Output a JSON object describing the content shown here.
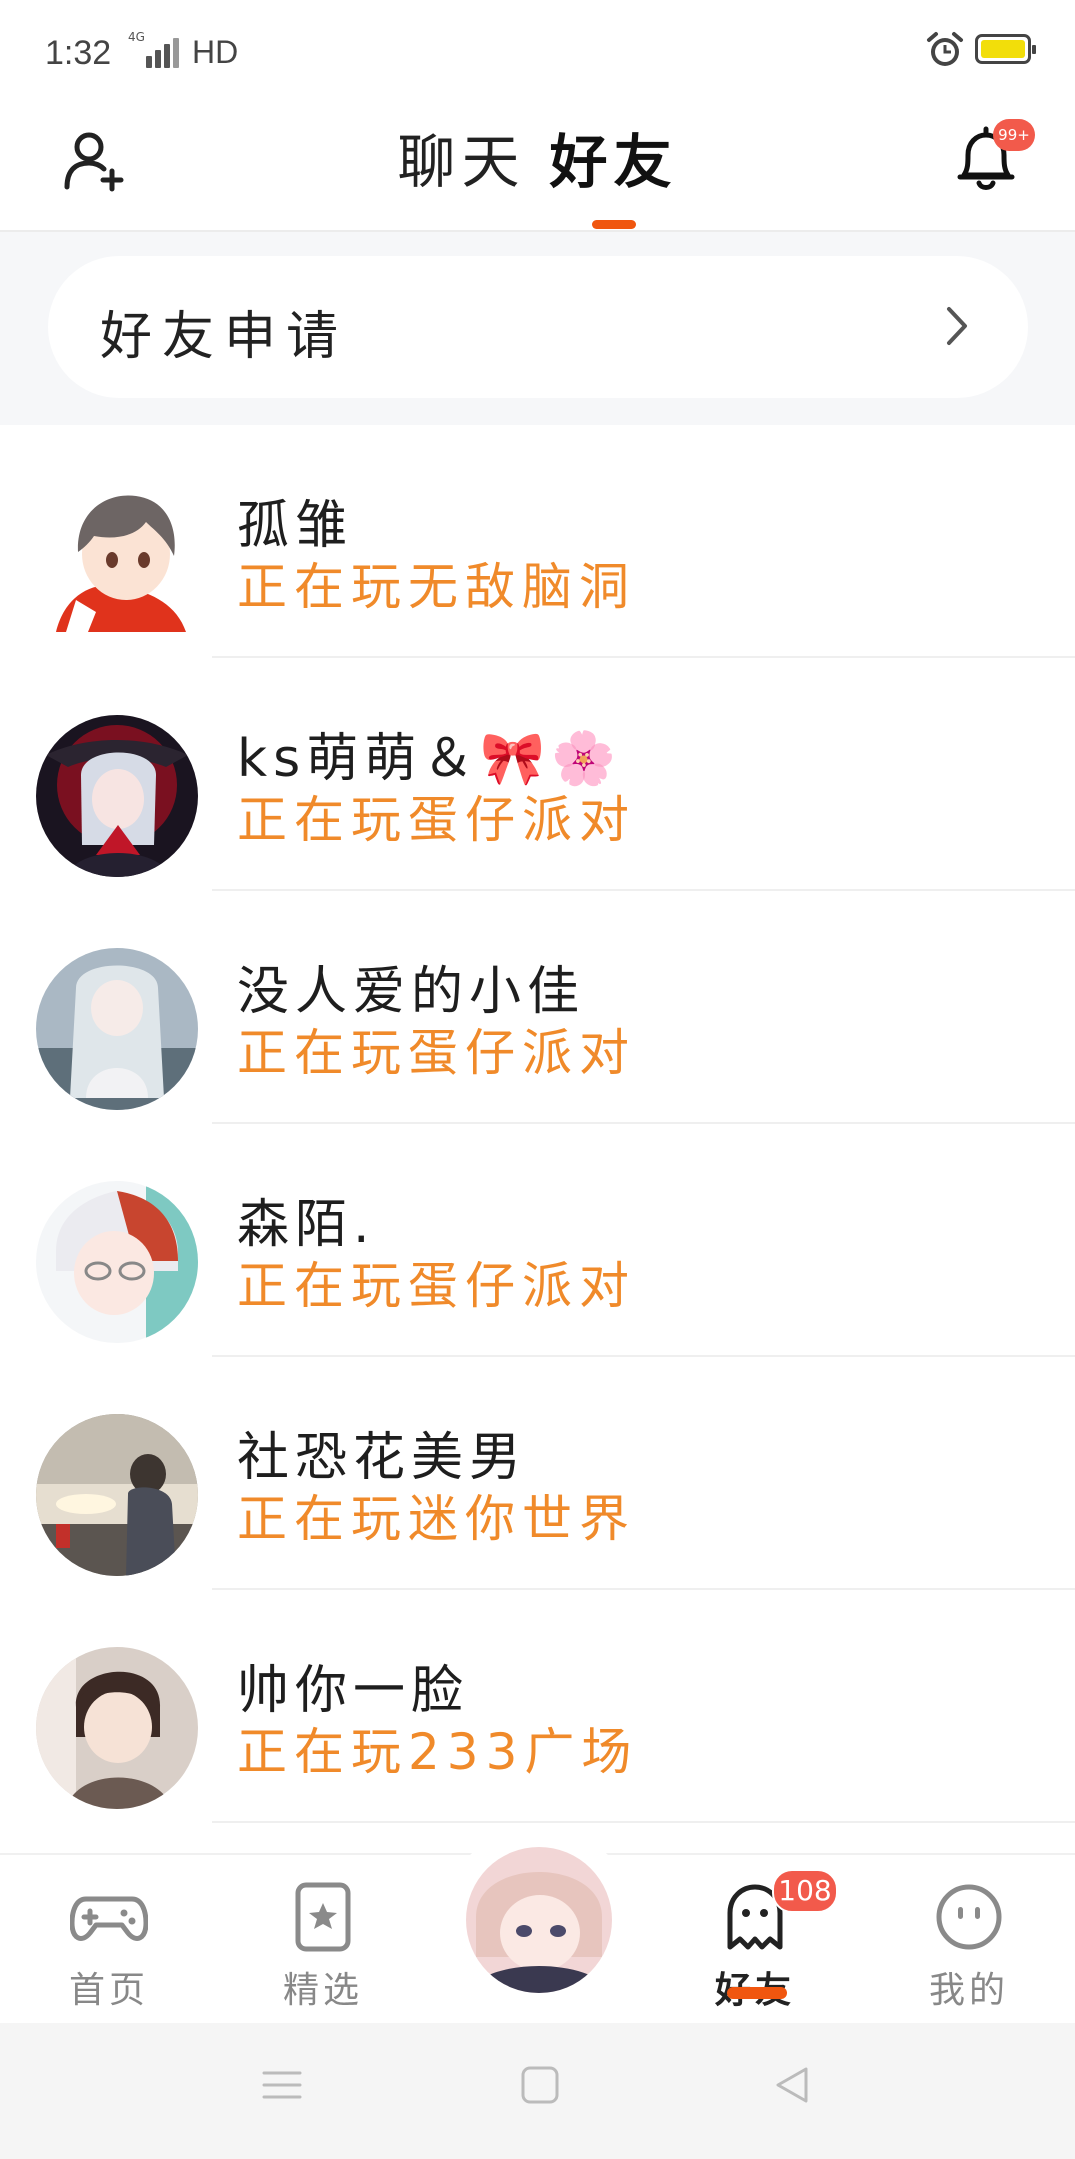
{
  "status_bar": {
    "time": "1:32",
    "network": "4G",
    "hd": "HD"
  },
  "header": {
    "tabs": [
      {
        "label": "聊天"
      },
      {
        "label": "好友"
      }
    ],
    "notification_badge": "99+"
  },
  "friend_requests": {
    "label": "好友申请"
  },
  "friends": [
    {
      "name": "孤雏",
      "status": "正在玩无敌脑洞"
    },
    {
      "name": "ks萌萌＆🎀🌸",
      "status": "正在玩蛋仔派对"
    },
    {
      "name": "没人爱的小佳",
      "status": "正在玩蛋仔派对"
    },
    {
      "name": "森陌.",
      "status": "正在玩蛋仔派对"
    },
    {
      "name": "社恐花美男",
      "status": "正在玩迷你世界"
    },
    {
      "name": "帅你一脸",
      "status": "正在玩233广场"
    }
  ],
  "bottom_nav": {
    "items": [
      {
        "label": "首页"
      },
      {
        "label": "精选"
      },
      {
        "label": "好友"
      },
      {
        "label": "我的"
      }
    ],
    "friends_badge": "108"
  },
  "colors": {
    "accent": "#f0560f",
    "status_text": "#f08a2a",
    "badge": "#f25a4b"
  }
}
